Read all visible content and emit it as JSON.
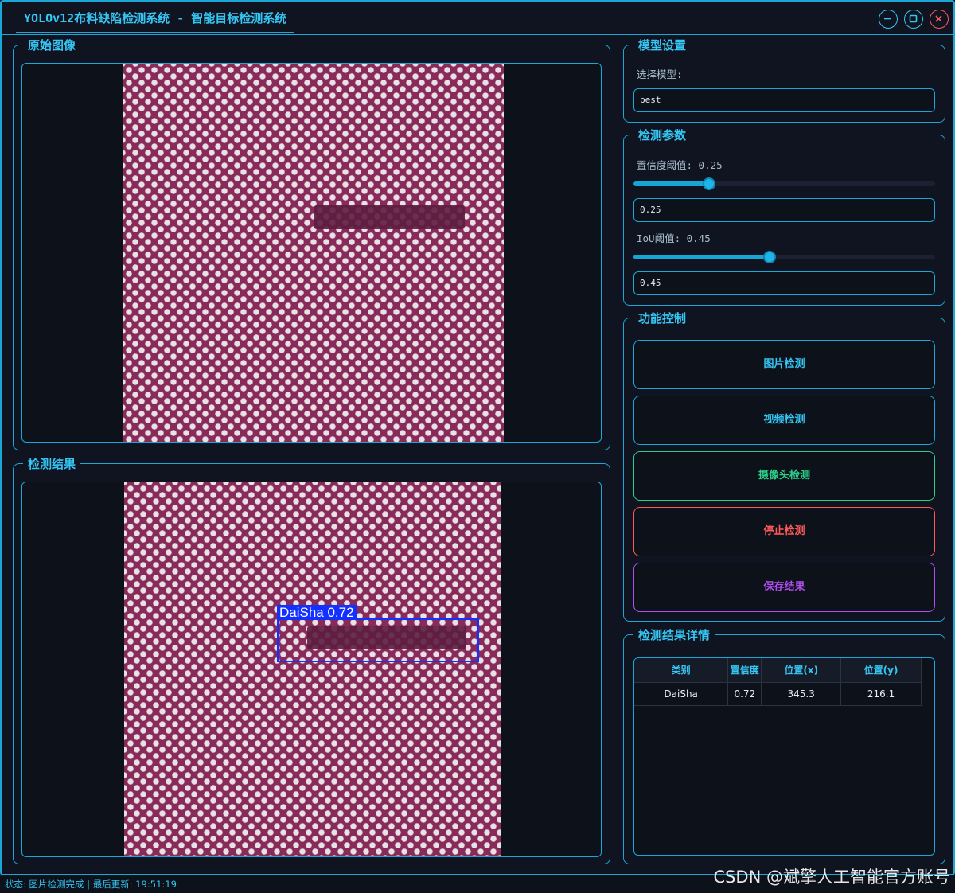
{
  "window": {
    "title": "YOLOv12布料缺陷检测系统 - 智能目标检测系统"
  },
  "panels": {
    "original_title": "原始图像",
    "result_title": "检测结果"
  },
  "detection_overlay": {
    "label": "DaiSha 0.72",
    "box_color": "#1230ff"
  },
  "model_settings": {
    "title": "模型设置",
    "select_label": "选择模型:",
    "selected_model": "best"
  },
  "detect_params": {
    "title": "检测参数",
    "conf_label": "置信度阈值: 0.25",
    "conf_value": "0.25",
    "conf_level": 0.25,
    "iou_label": "IoU阈值: 0.45",
    "iou_value": "0.45",
    "iou_level": 0.45
  },
  "controls": {
    "title": "功能控制",
    "image_detect": "图片检测",
    "video_detect": "视频检测",
    "camera_detect": "摄像头检测",
    "stop_detect": "停止检测",
    "save_result": "保存结果"
  },
  "results": {
    "title": "检测结果详情",
    "columns": [
      "类别",
      "置信度",
      "位置(x)",
      "位置(y)"
    ],
    "rows": [
      [
        "DaiSha",
        "0.72",
        "345.3",
        "216.1"
      ]
    ]
  },
  "status_bar": "状态: 图片检测完成 | 最后更新: 19:51:19",
  "watermark": "CSDN @斌擎人工智能官方账号",
  "colors": {
    "accent": "#35c6f4",
    "border": "#1aa7d8",
    "camera_button": "#2ccf8a",
    "stop_button": "#ff5a5a",
    "save_button": "#b04ff0",
    "fabric": "#8a2a5a"
  }
}
